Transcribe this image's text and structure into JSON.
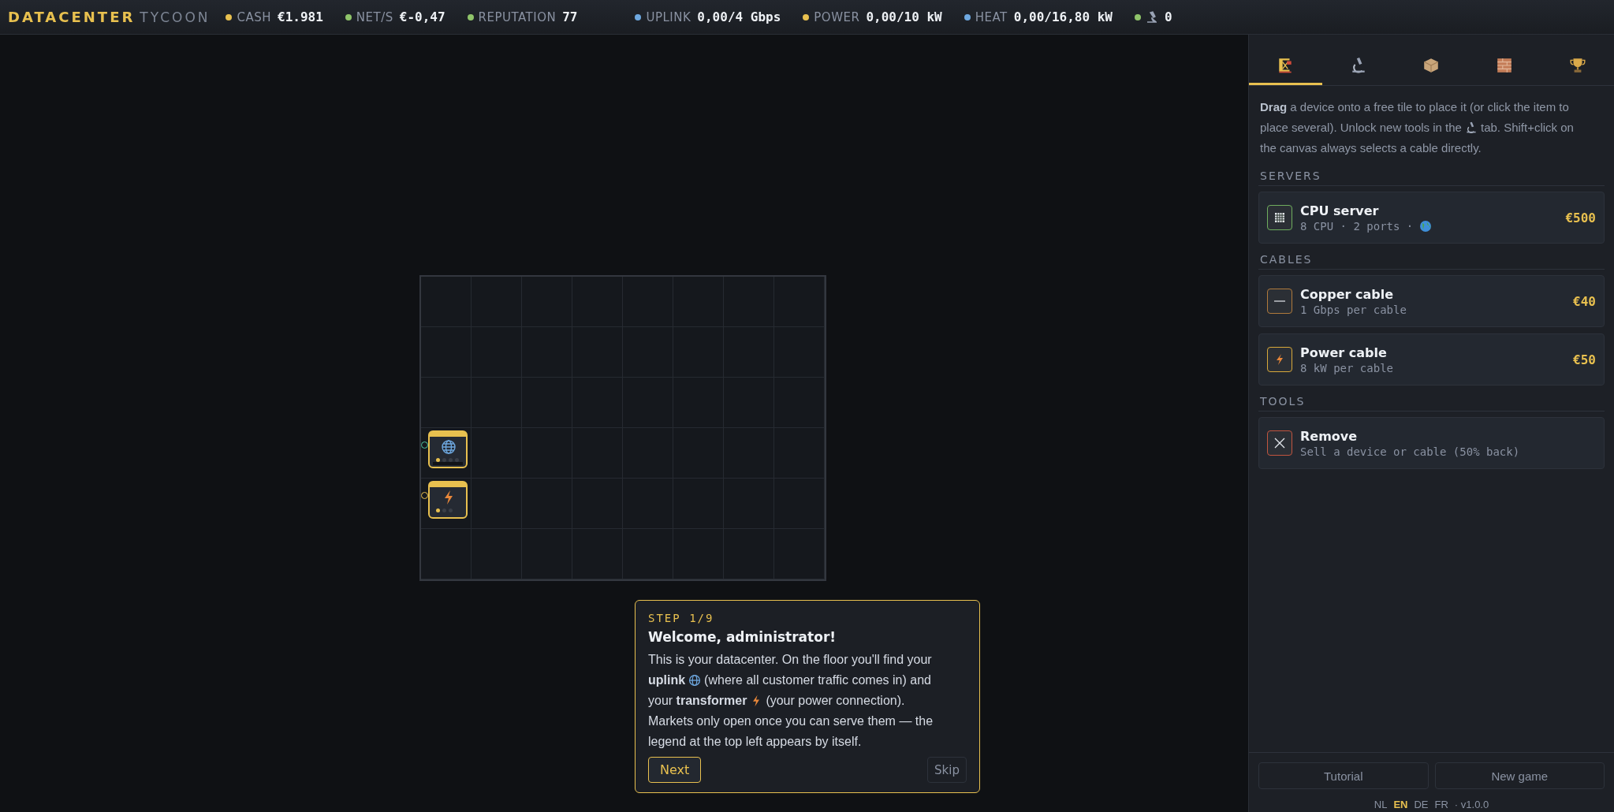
{
  "logo": {
    "main": "DATACENTER",
    "sub": "TYCOON"
  },
  "stats": [
    {
      "kind": "text",
      "label": "CASH",
      "value": "€1.981",
      "color": "#e8c04f"
    },
    {
      "kind": "text",
      "label": "NET/S",
      "value": "€-0,47",
      "color": "#8fc46a"
    },
    {
      "kind": "text",
      "label": "REPUTATION",
      "value": "77",
      "color": "#8fc46a"
    },
    {
      "kind": "text",
      "label": "UPLINK",
      "value": "0,00/4 Gbps",
      "color": "#6ea8e0"
    },
    {
      "kind": "text",
      "label": "POWER",
      "value": "0,00/10 kW",
      "color": "#e8c04f"
    },
    {
      "kind": "text",
      "label": "HEAT",
      "value": "0,00/16,80 kW",
      "color": "#6ea8e0"
    },
    {
      "kind": "research",
      "value": "0",
      "color": "#8fc46a"
    }
  ],
  "devices": [
    {
      "kind": "uplink"
    },
    {
      "kind": "transformer"
    }
  ],
  "tutorial": {
    "step": "STEP 1/9",
    "title": "Welcome, administrator!",
    "body": [
      {
        "kind": "plain",
        "parts": [
          "This is your datacenter. On the floor you'll find your"
        ]
      },
      {
        "kind": "globe",
        "parts": [
          "**uplink**",
          "(where all customer traffic comes in) and"
        ]
      },
      {
        "kind": "lightning",
        "parts": [
          "your **transformer**",
          "(your power connection)."
        ]
      },
      {
        "kind": "plain",
        "parts": [
          "Markets only open once you can serve them — the"
        ]
      },
      {
        "kind": "plain",
        "parts": [
          "legend at the top left appears by itself."
        ]
      }
    ],
    "next": "Next",
    "skip": "Skip"
  },
  "tabs": [
    {
      "kind": "build",
      "selected": true
    },
    {
      "kind": "research",
      "selected": false
    },
    {
      "kind": "shop",
      "selected": false
    },
    {
      "kind": "walls",
      "selected": false
    },
    {
      "kind": "trophies",
      "selected": false
    }
  ],
  "intro": [
    {
      "kind": "plain",
      "parts": [
        "**Drag** a device onto a free tile to place it (or click the item to"
      ]
    },
    {
      "kind": "microscope",
      "parts": [
        "place several). Unlock new tools in the",
        "tab. Shift+click on"
      ]
    },
    {
      "kind": "plain",
      "parts": [
        "the canvas always selects a cable directly."
      ]
    }
  ],
  "sections": [
    {
      "title": "SERVERS",
      "items": [
        {
          "kind": "server",
          "name": "CPU server",
          "detail": "8 CPU · 2 ports ·",
          "price": "€500",
          "color": "#6fae5e"
        }
      ]
    },
    {
      "title": "CABLES",
      "items": [
        {
          "kind": "copper",
          "name": "Copper cable",
          "detail": "1 Gbps per cable",
          "price": "€40",
          "color": "#b07a3c"
        },
        {
          "kind": "power",
          "name": "Power cable",
          "detail": "8 kW per cable",
          "price": "€50",
          "color": "#d8a93a"
        }
      ]
    },
    {
      "title": "TOOLS",
      "items": [
        {
          "kind": "remove",
          "name": "Remove",
          "detail": "Sell a device or cable (50% back)",
          "color": "#c2553f"
        }
      ]
    }
  ],
  "footer": {
    "buttons": [
      "Tutorial",
      "New game"
    ],
    "languages": [
      {
        "label": "NL",
        "selected": false
      },
      {
        "label": "EN",
        "selected": true
      },
      {
        "label": "DE",
        "selected": false
      },
      {
        "label": "FR",
        "selected": false
      }
    ],
    "version": "· v1.0.0"
  }
}
